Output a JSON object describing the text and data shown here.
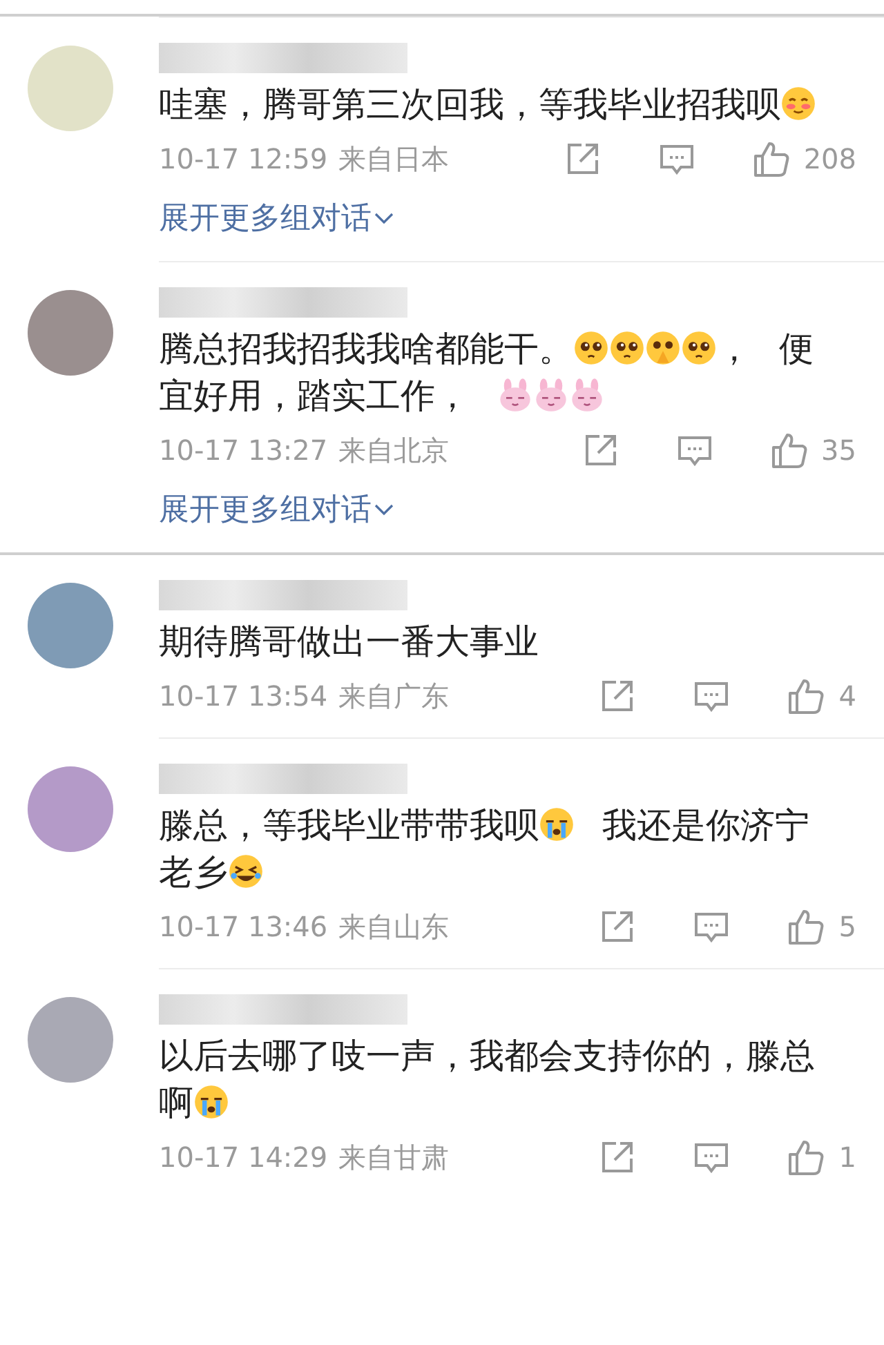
{
  "groups": [
    {
      "comments": [
        {
          "content": [
            {
              "kind": "text",
              "text": "哇塞，腾哥第三次回我，等我毕业招我呗"
            },
            {
              "kind": "blush"
            }
          ],
          "time": "10-17 12:59",
          "location": "来自日本",
          "likes": "208",
          "expand_link": "展开更多组对话"
        },
        {
          "content": [
            {
              "kind": "text",
              "text": "腾总招我招我我啥都能干。"
            },
            {
              "kind": "pleading"
            },
            {
              "kind": "pleading"
            },
            {
              "kind": "hands"
            },
            {
              "kind": "pleading"
            },
            {
              "kind": "text",
              "text": "， 便宜好用，踏实工作， "
            },
            {
              "kind": "rabbit"
            },
            {
              "kind": "rabbit"
            },
            {
              "kind": "rabbit"
            }
          ],
          "time": "10-17 13:27",
          "location": "来自北京",
          "likes": "35",
          "expand_link": "展开更多组对话"
        }
      ]
    },
    {
      "comments": [
        {
          "content": [
            {
              "kind": "text",
              "text": "期待腾哥做出一番大事业"
            }
          ],
          "time": "10-17 13:54",
          "location": "来自广东",
          "likes": "4"
        },
        {
          "content": [
            {
              "kind": "text",
              "text": "滕总，等我毕业带带我呗"
            },
            {
              "kind": "crying"
            },
            {
              "kind": "text",
              "text": " 我还是你济宁老乡"
            },
            {
              "kind": "laughing"
            }
          ],
          "time": "10-17 13:46",
          "location": "来自山东",
          "likes": "5"
        },
        {
          "content": [
            {
              "kind": "text",
              "text": "以后去哪了吱一声，我都会支持你的，滕总啊"
            },
            {
              "kind": "crying"
            }
          ],
          "time": "10-17 14:29",
          "location": "来自甘肃",
          "likes": "1"
        }
      ]
    }
  ]
}
